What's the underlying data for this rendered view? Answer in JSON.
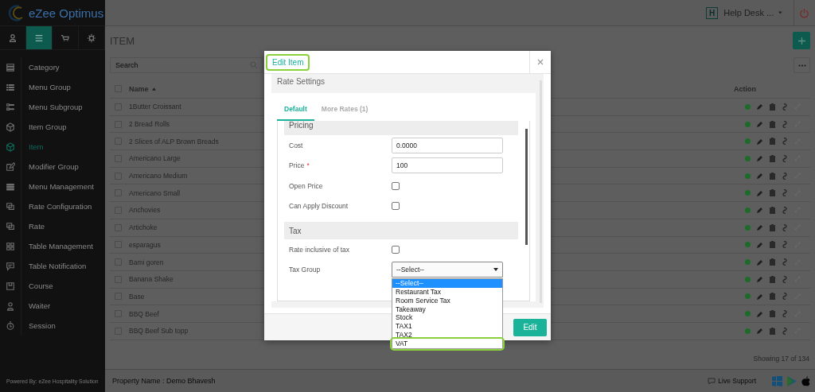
{
  "sidebar": {
    "logo": "eZee Optimus",
    "tabs": [
      {
        "selected": false
      },
      {
        "selected": true
      },
      {
        "selected": false
      },
      {
        "selected": false
      }
    ],
    "items": [
      {
        "label": "Category",
        "selected": false
      },
      {
        "label": "Menu Group",
        "selected": false
      },
      {
        "label": "Menu Subgroup",
        "selected": false
      },
      {
        "label": "Item Group",
        "selected": false
      },
      {
        "label": "Item",
        "selected": true
      },
      {
        "label": "Modifier Group",
        "selected": false
      },
      {
        "label": "Menu Management",
        "selected": false
      },
      {
        "label": "Rate Configuration",
        "selected": false
      },
      {
        "label": "Rate",
        "selected": false
      },
      {
        "label": "Table Management",
        "selected": false
      },
      {
        "label": "Table Notification",
        "selected": false
      },
      {
        "label": "Course",
        "selected": false
      },
      {
        "label": "Waiter",
        "selected": false
      },
      {
        "label": "Session",
        "selected": false
      }
    ],
    "footer": "Powered By: eZee Hospitality Solution"
  },
  "header": {
    "user_badge": "H",
    "user": "Help Desk ..."
  },
  "page": {
    "title": "ITEM",
    "search": {
      "placeholder": "Search"
    },
    "table": {
      "columns": [
        "Name",
        "Action"
      ],
      "header_checked": false,
      "rows": [
        {
          "name": "1Butter Croissant",
          "checked": false,
          "active": true
        },
        {
          "name": "2 Bread Rolls",
          "checked": false,
          "active": true
        },
        {
          "name": "2 Slices of ALP Brown Breads",
          "checked": false,
          "active": true
        },
        {
          "name": "Americano Large",
          "checked": false,
          "active": true
        },
        {
          "name": "Americano Medium",
          "checked": false,
          "active": true
        },
        {
          "name": "Americano Small",
          "checked": false,
          "active": true
        },
        {
          "name": "Anchovies",
          "checked": false,
          "active": true
        },
        {
          "name": "Artichoke",
          "checked": false,
          "active": true
        },
        {
          "name": "esparagus",
          "checked": false,
          "active": true
        },
        {
          "name": "Bami goren",
          "checked": false,
          "active": true
        },
        {
          "name": "Banana Shake",
          "checked": false,
          "active": true
        },
        {
          "name": "Base",
          "checked": false,
          "active": true
        },
        {
          "name": "BBQ Beef",
          "checked": false,
          "active": true
        },
        {
          "name": "BBQ Beef Sub topp",
          "checked": false,
          "active": true
        }
      ]
    },
    "showing": "Showing 17 of 134"
  },
  "footer": {
    "property": "Property Name : Demo Bhavesh",
    "support": "Live Support"
  },
  "dialog": {
    "title": {
      "text": "Edit Item",
      "highlighted": true
    },
    "section": "Rate Settings",
    "tabs": [
      {
        "label": "Default",
        "selected": true
      },
      {
        "label": "More Rates (1)",
        "selected": false
      }
    ],
    "groups": [
      {
        "title": "Pricing",
        "fields": [
          {
            "kind": "text",
            "label": "Cost",
            "value": "0.0000"
          },
          {
            "kind": "text",
            "label": "Price",
            "required_mark": "*",
            "value": "100"
          },
          {
            "kind": "checkbox",
            "label": "Open Price",
            "checked": false
          },
          {
            "kind": "checkbox",
            "label": "Can Apply Discount",
            "checked": false
          }
        ]
      },
      {
        "title": "Tax",
        "fields": [
          {
            "kind": "checkbox",
            "label": "Rate inclusive of tax",
            "checked": false
          },
          {
            "kind": "select",
            "label": "Tax Group",
            "value": "--Select--",
            "expanded": true,
            "options": [
              {
                "label": "--Select--",
                "selected": true,
                "highlighted": false
              },
              {
                "label": "Restaurant Tax",
                "selected": false,
                "highlighted": false
              },
              {
                "label": "Room Service Tax",
                "selected": false,
                "highlighted": false
              },
              {
                "label": "Takeaway",
                "selected": false,
                "highlighted": false
              },
              {
                "label": "Stock",
                "selected": false,
                "highlighted": false
              },
              {
                "label": "TAX1",
                "selected": false,
                "highlighted": false
              },
              {
                "label": "TAX2",
                "selected": false,
                "highlighted": false
              },
              {
                "label": "VAT",
                "selected": false,
                "highlighted": true
              }
            ]
          }
        ]
      }
    ],
    "button": "Edit"
  }
}
